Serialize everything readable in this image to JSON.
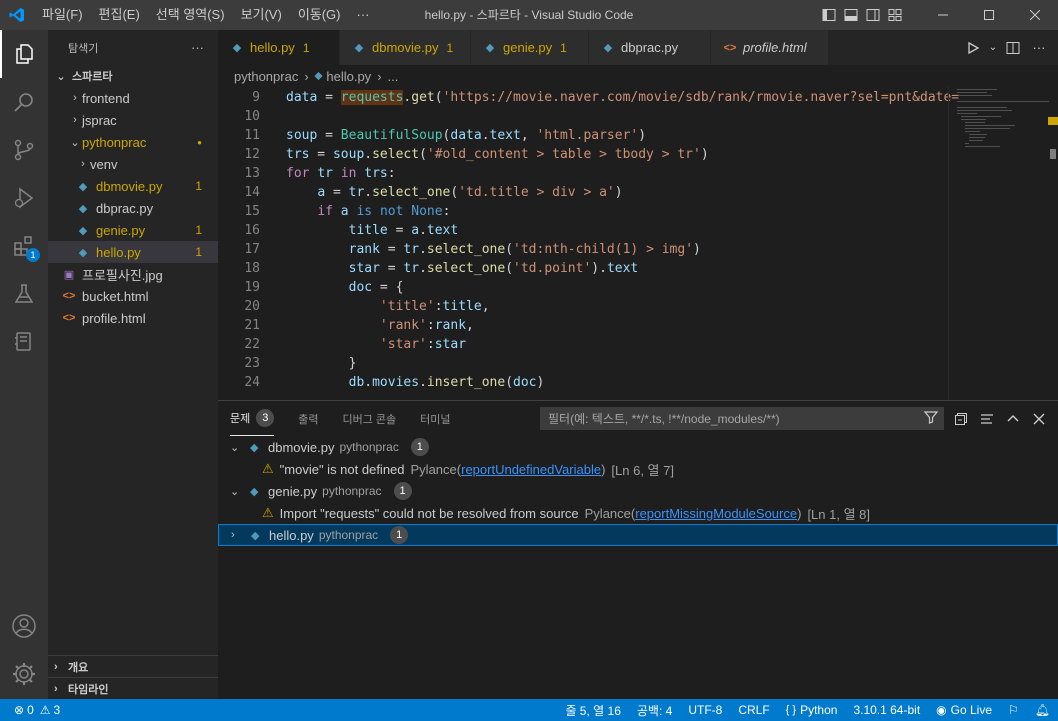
{
  "title_bar": {
    "menus": [
      "파일(F)",
      "편집(E)",
      "선택 영역(S)",
      "보기(V)",
      "이동(G)",
      "···"
    ],
    "window_title": "hello.py - 스파르타 - Visual Studio Code"
  },
  "activity_bar": {
    "extensions_badge": "1"
  },
  "sidebar": {
    "header": "탐색기",
    "more": "···",
    "root": "스파르타",
    "tree": [
      {
        "label": "frontend",
        "type": "folder",
        "expanded": false,
        "color": "#cccccc",
        "count": ""
      },
      {
        "label": "jsprac",
        "type": "folder",
        "expanded": false,
        "color": "#cccccc",
        "count": ""
      },
      {
        "label": "pythonprac",
        "type": "folder",
        "expanded": true,
        "color": "#cca700",
        "count": "●"
      },
      {
        "label": "venv",
        "type": "folder",
        "expanded": false,
        "color": "#cccccc",
        "count": ""
      },
      {
        "label": "dbmovie.py",
        "type": "py",
        "color": "#cca700",
        "count": "1"
      },
      {
        "label": "dbprac.py",
        "type": "py",
        "color": "#cccccc",
        "count": ""
      },
      {
        "label": "genie.py",
        "type": "py",
        "color": "#cca700",
        "count": "1"
      },
      {
        "label": "hello.py",
        "type": "py",
        "color": "#cca700",
        "count": "1"
      },
      {
        "label": "프로필사진.jpg",
        "type": "img",
        "color": "#cccccc",
        "count": ""
      },
      {
        "label": "bucket.html",
        "type": "html",
        "color": "#cccccc",
        "count": ""
      },
      {
        "label": "profile.html",
        "type": "html",
        "color": "#cccccc",
        "count": ""
      }
    ],
    "outline": "개요",
    "timeline": "타임라인"
  },
  "tabs": [
    {
      "label": "hello.py",
      "count": "1",
      "active": true,
      "italic": false,
      "icon": "py",
      "color": "#cca700"
    },
    {
      "label": "dbmovie.py",
      "count": "1",
      "active": false,
      "italic": false,
      "icon": "py",
      "color": "#cca700"
    },
    {
      "label": "genie.py",
      "count": "1",
      "active": false,
      "italic": false,
      "icon": "py",
      "color": "#cca700"
    },
    {
      "label": "dbprac.py",
      "count": "",
      "active": false,
      "italic": false,
      "icon": "py",
      "color": "#cccccc"
    },
    {
      "label": "profile.html",
      "count": "",
      "active": false,
      "italic": true,
      "icon": "html",
      "color": "#cccccc"
    }
  ],
  "breadcrumb": {
    "folder": "pythonprac",
    "file": "hello.py",
    "more": "..."
  },
  "code_lines": [
    {
      "n": "9",
      "tokens": [
        [
          "v",
          "data"
        ],
        [
          "w",
          " = "
        ],
        [
          "c",
          "requests"
        ],
        [
          "w",
          "."
        ],
        [
          "f",
          "get"
        ],
        [
          "w",
          "("
        ],
        [
          "s",
          "'https://movie.naver.com/movie/sdb/rank/rmovie.naver?sel=pnt&date="
        ]
      ]
    },
    {
      "n": "10",
      "tokens": []
    },
    {
      "n": "11",
      "tokens": [
        [
          "v",
          "soup"
        ],
        [
          "w",
          " = "
        ],
        [
          "c",
          "BeautifulSoup"
        ],
        [
          "w",
          "("
        ],
        [
          "v",
          "data"
        ],
        [
          "w",
          "."
        ],
        [
          "v",
          "text"
        ],
        [
          "w",
          ", "
        ],
        [
          "s",
          "'html.parser'"
        ],
        [
          "w",
          ")"
        ]
      ]
    },
    {
      "n": "12",
      "tokens": [
        [
          "v",
          "trs"
        ],
        [
          "w",
          " = "
        ],
        [
          "v",
          "soup"
        ],
        [
          "w",
          "."
        ],
        [
          "f",
          "select"
        ],
        [
          "w",
          "("
        ],
        [
          "s",
          "'#old_content > table > tbody > tr'"
        ],
        [
          "w",
          ")"
        ]
      ]
    },
    {
      "n": "13",
      "tokens": [
        [
          "k",
          "for"
        ],
        [
          "w",
          " "
        ],
        [
          "v",
          "tr"
        ],
        [
          "w",
          " "
        ],
        [
          "k",
          "in"
        ],
        [
          "w",
          " "
        ],
        [
          "v",
          "trs"
        ],
        [
          "w",
          ":"
        ]
      ]
    },
    {
      "n": "14",
      "tokens": [
        [
          "w",
          "    "
        ],
        [
          "v",
          "a"
        ],
        [
          "w",
          " = "
        ],
        [
          "v",
          "tr"
        ],
        [
          "w",
          "."
        ],
        [
          "f",
          "select_one"
        ],
        [
          "w",
          "("
        ],
        [
          "s",
          "'td.title > div > a'"
        ],
        [
          "w",
          ")"
        ]
      ]
    },
    {
      "n": "15",
      "tokens": [
        [
          "w",
          "    "
        ],
        [
          "k",
          "if"
        ],
        [
          "w",
          " "
        ],
        [
          "v",
          "a"
        ],
        [
          "w",
          " "
        ],
        [
          "b",
          "is"
        ],
        [
          "w",
          " "
        ],
        [
          "b",
          "not"
        ],
        [
          "w",
          " "
        ],
        [
          "b",
          "None"
        ],
        [
          "w",
          ":"
        ]
      ]
    },
    {
      "n": "16",
      "tokens": [
        [
          "w",
          "        "
        ],
        [
          "v",
          "title"
        ],
        [
          "w",
          " = "
        ],
        [
          "v",
          "a"
        ],
        [
          "w",
          "."
        ],
        [
          "v",
          "text"
        ]
      ]
    },
    {
      "n": "17",
      "tokens": [
        [
          "w",
          "        "
        ],
        [
          "v",
          "rank"
        ],
        [
          "w",
          " = "
        ],
        [
          "v",
          "tr"
        ],
        [
          "w",
          "."
        ],
        [
          "f",
          "select_one"
        ],
        [
          "w",
          "("
        ],
        [
          "s",
          "'td:nth-child(1) > img'"
        ],
        [
          "w",
          ")"
        ]
      ]
    },
    {
      "n": "18",
      "tokens": [
        [
          "w",
          "        "
        ],
        [
          "v",
          "star"
        ],
        [
          "w",
          " = "
        ],
        [
          "v",
          "tr"
        ],
        [
          "w",
          "."
        ],
        [
          "f",
          "select_one"
        ],
        [
          "w",
          "("
        ],
        [
          "s",
          "'td.point'"
        ],
        [
          "w",
          ")."
        ],
        [
          "v",
          "text"
        ]
      ]
    },
    {
      "n": "19",
      "tokens": [
        [
          "w",
          "        "
        ],
        [
          "v",
          "doc"
        ],
        [
          "w",
          " = {"
        ]
      ]
    },
    {
      "n": "20",
      "tokens": [
        [
          "w",
          "            "
        ],
        [
          "s",
          "'title'"
        ],
        [
          "w",
          ":"
        ],
        [
          "v",
          "title"
        ],
        [
          "w",
          ","
        ]
      ]
    },
    {
      "n": "21",
      "tokens": [
        [
          "w",
          "            "
        ],
        [
          "s",
          "'rank'"
        ],
        [
          "w",
          ":"
        ],
        [
          "v",
          "rank"
        ],
        [
          "w",
          ","
        ]
      ]
    },
    {
      "n": "22",
      "tokens": [
        [
          "w",
          "            "
        ],
        [
          "s",
          "'star'"
        ],
        [
          "w",
          ":"
        ],
        [
          "v",
          "star"
        ]
      ]
    },
    {
      "n": "23",
      "tokens": [
        [
          "w",
          "        }"
        ]
      ]
    },
    {
      "n": "24",
      "tokens": [
        [
          "w",
          "        "
        ],
        [
          "v",
          "db"
        ],
        [
          "w",
          "."
        ],
        [
          "v",
          "movies"
        ],
        [
          "w",
          "."
        ],
        [
          "f",
          "insert_one"
        ],
        [
          "w",
          "("
        ],
        [
          "v",
          "doc"
        ],
        [
          "w",
          ")"
        ]
      ]
    }
  ],
  "panel": {
    "tabs": [
      {
        "label": "문제",
        "badge": "3",
        "active": true
      },
      {
        "label": "출력",
        "badge": "",
        "active": false
      },
      {
        "label": "디버그 콘솔",
        "badge": "",
        "active": false
      },
      {
        "label": "터미널",
        "badge": "",
        "active": false
      }
    ],
    "filter_placeholder": "필터(예: 텍스트, **/*.ts, !**/node_modules/**)",
    "problems": [
      {
        "file": "dbmovie.py",
        "dir": "pythonprac",
        "count": "1",
        "expanded": true,
        "message": "\"movie\" is not defined",
        "source": "Pylance",
        "code": "reportUndefinedVariable",
        "location": "[Ln 6, 열 7]"
      },
      {
        "file": "genie.py",
        "dir": "pythonprac",
        "count": "1",
        "expanded": true,
        "message": "Import \"requests\" could not be resolved from source",
        "source": "Pylance",
        "code": "reportMissingModuleSource",
        "location": "[Ln 1, 열 8]"
      },
      {
        "file": "hello.py",
        "dir": "pythonprac",
        "count": "1",
        "expanded": false
      }
    ]
  },
  "status_bar": {
    "errors": "0",
    "warnings": "3",
    "position": "줄 5, 열 16",
    "spaces": "공백: 4",
    "encoding": "UTF-8",
    "eol": "CRLF",
    "language": "Python",
    "interpreter": "3.10.1 64-bit",
    "live": "Go Live"
  },
  "colors": {
    "accent": "#007acc",
    "warning": "#cca700",
    "python_icon": "#519aba",
    "html_icon": "#e37933"
  }
}
